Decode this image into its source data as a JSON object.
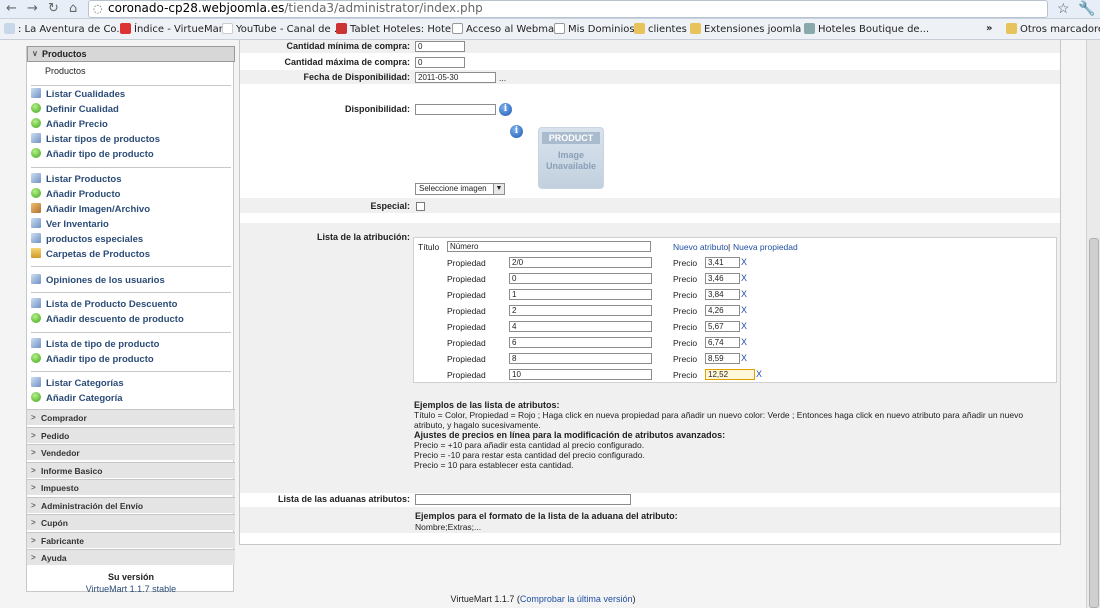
{
  "browser": {
    "url_host": "coronado-cp28.webjoomla.es",
    "url_path": "/tienda3/administrator/index.php",
    "bookmarks": [
      ": La Aventura de Co...",
      "Índice - VirtueMart",
      "YouTube - Canal de ...",
      "Tablet Hoteles: Hote...",
      "Acceso al Webmail",
      "Mis Dominios",
      "clientes",
      "Extensiones joomla ...",
      "Hoteles Boutique de..."
    ],
    "more_bookmarks": "»",
    "other_bookmarks": "Otros marcadores"
  },
  "sidebar": {
    "header": "Productos",
    "sub": "Productos",
    "items": [
      {
        "label": "Listar Cualidades",
        "icon": "doc"
      },
      {
        "label": "Definir Cualidad",
        "icon": "green"
      },
      {
        "label": "Añadir Precio",
        "icon": "green"
      },
      {
        "label": "Listar tipos de productos",
        "icon": "doc"
      },
      {
        "label": "Añadir tipo de producto",
        "icon": "green"
      },
      {
        "label": "Listar Productos",
        "icon": "doc"
      },
      {
        "label": "Añadir Producto",
        "icon": "green"
      },
      {
        "label": "Añadir Imagen/Archivo",
        "icon": "img"
      },
      {
        "label": "Ver Inventario",
        "icon": "doc"
      },
      {
        "label": "productos especiales",
        "icon": "doc"
      },
      {
        "label": "Carpetas de Productos",
        "icon": "folder"
      },
      {
        "label": "Opiniones de los usuarios",
        "icon": "doc"
      },
      {
        "label": "Lista de Producto Descuento",
        "icon": "doc"
      },
      {
        "label": "Añadir descuento de producto",
        "icon": "green"
      },
      {
        "label": "Lista de tipo de producto",
        "icon": "doc"
      },
      {
        "label": "Añadir tipo de producto",
        "icon": "green"
      },
      {
        "label": "Listar Categorías",
        "icon": "doc"
      },
      {
        "label": "Añadir Categoría",
        "icon": "green"
      }
    ],
    "groups": [
      "Comprador",
      "Pedido",
      "Vendedor",
      "Informe Basico",
      "Impuesto",
      "Administración del Envío",
      "Cupón",
      "Fabricante",
      "Ayuda"
    ],
    "version_title": "Su versión",
    "version": "VirtueMart 1.1.7 stable"
  },
  "form": {
    "min_qty_label": "Cantidad mínima de compra:",
    "min_qty": "0",
    "max_qty_label": "Cantidad máxima de compra:",
    "max_qty": "0",
    "avail_date_label": "Fecha de Disponibilidad:",
    "avail_date": "2011-05-30",
    "date_picker": "...",
    "availability_label": "Disponibilidad:",
    "availability": "",
    "image_text_1": "PRODUCT",
    "image_text_2": "Image Unavailable",
    "image_select": "Seleccione imagen",
    "special_label": "Especial:",
    "attr_list_label": "Lista de la atribución:",
    "attr": {
      "title_label": "Título",
      "title_value": "Número",
      "new_attr": "Nuevo atributo",
      "sep": "|",
      "new_prop": "Nueva propiedad",
      "prop_label": "Propiedad",
      "price_label": "Precio",
      "delete": "X",
      "rows": [
        {
          "prop": "2/0",
          "price": "3,41"
        },
        {
          "prop": "0",
          "price": "3,46"
        },
        {
          "prop": "1",
          "price": "3,84"
        },
        {
          "prop": "2",
          "price": "4,26"
        },
        {
          "prop": "4",
          "price": "5,67"
        },
        {
          "prop": "6",
          "price": "6,74"
        },
        {
          "prop": "8",
          "price": "8,59"
        },
        {
          "prop": "10",
          "price": "12,52"
        }
      ]
    },
    "examples_title": "Ejemplos de las lista de atributos:",
    "examples_text": "Título = Color, Propiedad = Rojo ; Haga click en nueva propiedad para añadir un nuevo color: Verde ; Entonces haga click en nuevo atributo para añadir un nuevo atributo, y hagalo sucesivamente.",
    "price_adj_title": "Ajustes de precios en línea para la modificación de atributos avanzados:",
    "price_adj_1": "Precio = +10 para añadir esta cantidad al precio configurado.",
    "price_adj_2": "Precio = -10 para restar esta cantidad del precio configurado.",
    "price_adj_3": "Precio = 10 para establecer esta cantidad.",
    "customs_label": "Lista de las aduanas atributos:",
    "customs_value": "",
    "customs_example_title": "Ejemplos para el formato de la lista de la aduana del atributo:",
    "customs_example_text": "Nombre;Extras;..."
  },
  "footer": {
    "text": "VirtueMart 1.1.7 (",
    "link": "Comprobar la última versión",
    "end": ")"
  }
}
